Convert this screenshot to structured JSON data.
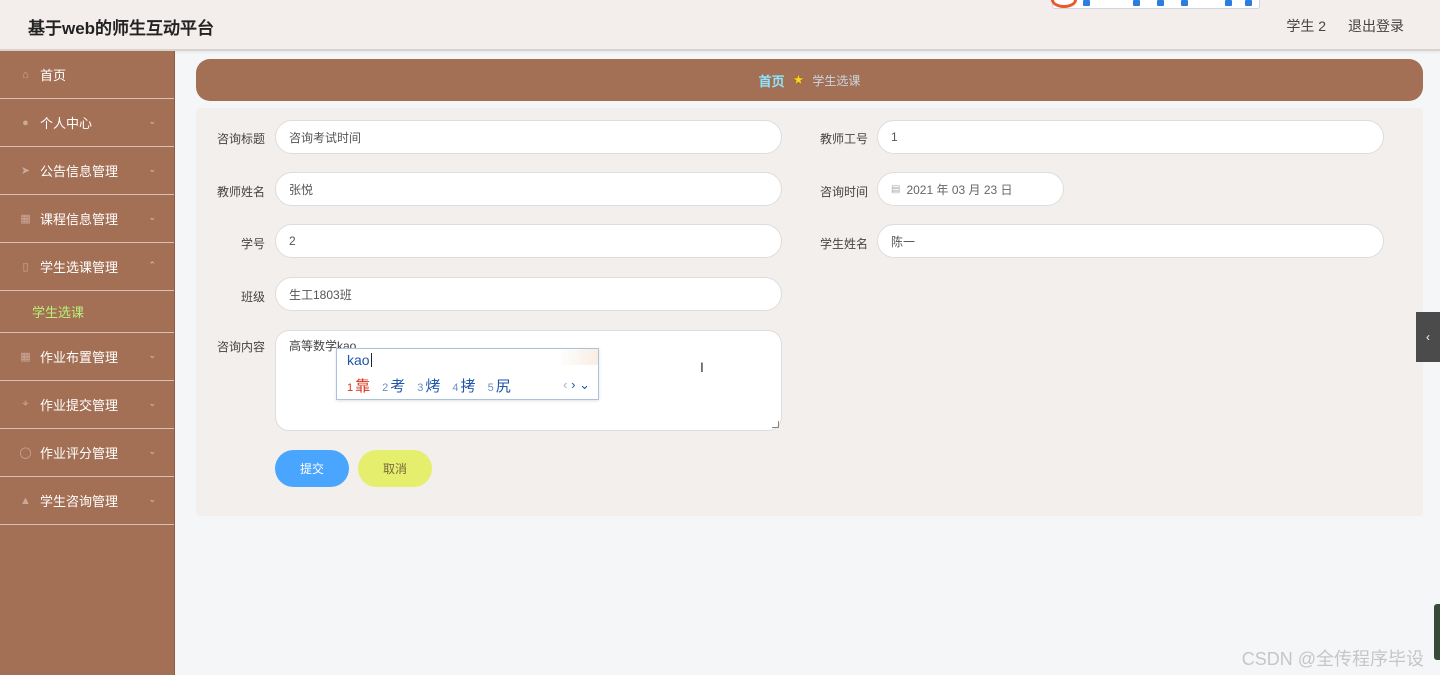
{
  "header": {
    "title": "基于web的师生互动平台",
    "user_label": "学生 2",
    "logout_label": "退出登录"
  },
  "sidebar": {
    "items": [
      {
        "label": "首页",
        "icon": "home-icon"
      },
      {
        "label": "个人中心",
        "icon": "user-icon"
      },
      {
        "label": "公告信息管理",
        "icon": "send-icon"
      },
      {
        "label": "课程信息管理",
        "icon": "grid-icon"
      },
      {
        "label": "学生选课管理",
        "icon": "clipboard-icon"
      },
      {
        "label": "作业布置管理",
        "icon": "table-icon"
      },
      {
        "label": "作业提交管理",
        "icon": "crop-icon"
      },
      {
        "label": "作业评分管理",
        "icon": "globe-icon"
      },
      {
        "label": "学生咨询管理",
        "icon": "thumb-icon"
      }
    ],
    "submenu": {
      "label": "学生选课"
    }
  },
  "breadcrumb": {
    "home": "首页",
    "current": "学生选课"
  },
  "form": {
    "consult_title": {
      "label": "咨询标题",
      "value": "咨询考试时间"
    },
    "teacher_id": {
      "label": "教师工号",
      "value": "1"
    },
    "teacher_name": {
      "label": "教师姓名",
      "value": "张悦"
    },
    "consult_time": {
      "label": "咨询时间",
      "value": "2021 年 03 月 23 日"
    },
    "student_id": {
      "label": "学号",
      "value": "2"
    },
    "student_name": {
      "label": "学生姓名",
      "value": "陈一"
    },
    "class_name": {
      "label": "班级",
      "value": "生工1803班"
    },
    "consult_content": {
      "label": "咨询内容",
      "value": "高等数学kao"
    },
    "submit_label": "提交",
    "cancel_label": "取消"
  },
  "ime": {
    "pinyin": "kao",
    "candidates": [
      {
        "n": "1",
        "char": "靠"
      },
      {
        "n": "2",
        "char": "考"
      },
      {
        "n": "3",
        "char": "烤"
      },
      {
        "n": "4",
        "char": "拷"
      },
      {
        "n": "5",
        "char": "尻"
      }
    ]
  },
  "watermark": "CSDN @全传程序毕设",
  "colors": {
    "sidebar_bg": "#a47055",
    "breadcrumb_home": "#8de6ff",
    "submenu_active": "#b8f07a",
    "submit_button": "#4aa5ff",
    "cancel_button": "#e6ee6e"
  }
}
